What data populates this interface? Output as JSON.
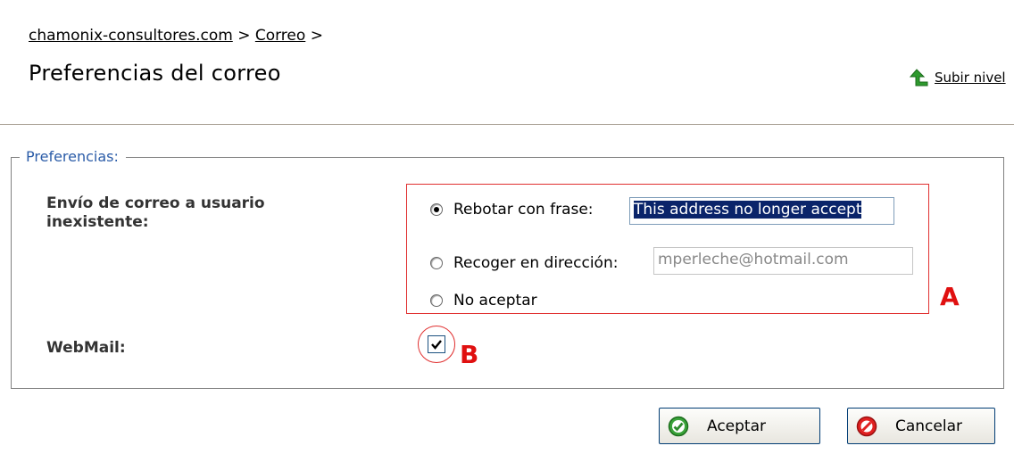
{
  "breadcrumb": {
    "items": [
      "chamonix-consultores.com",
      "Correo"
    ],
    "separator": ">"
  },
  "page": {
    "title": "Preferencias del correo",
    "up_level": "Subir nivel"
  },
  "preferences": {
    "legend": "Preferencias:",
    "nonexistent_user_label": "Envío de correo a usuario inexistente:",
    "options": {
      "bounce_label": "Rebotar con frase:",
      "bounce_value": "This address no longer accept",
      "forward_label": "Recoger en dirección:",
      "forward_value": "mperleche@hotmail.com",
      "reject_label": "No aceptar"
    },
    "selected_option": "bounce",
    "webmail_label": "WebMail:",
    "webmail_checked": true
  },
  "annotations": {
    "a": "A",
    "b": "B"
  },
  "buttons": {
    "ok": "Aceptar",
    "cancel": "Cancelar"
  },
  "colors": {
    "accent_blue": "#2b5ca8",
    "annotation_red": "#e03030",
    "up_arrow_green": "#2e9a2e"
  }
}
